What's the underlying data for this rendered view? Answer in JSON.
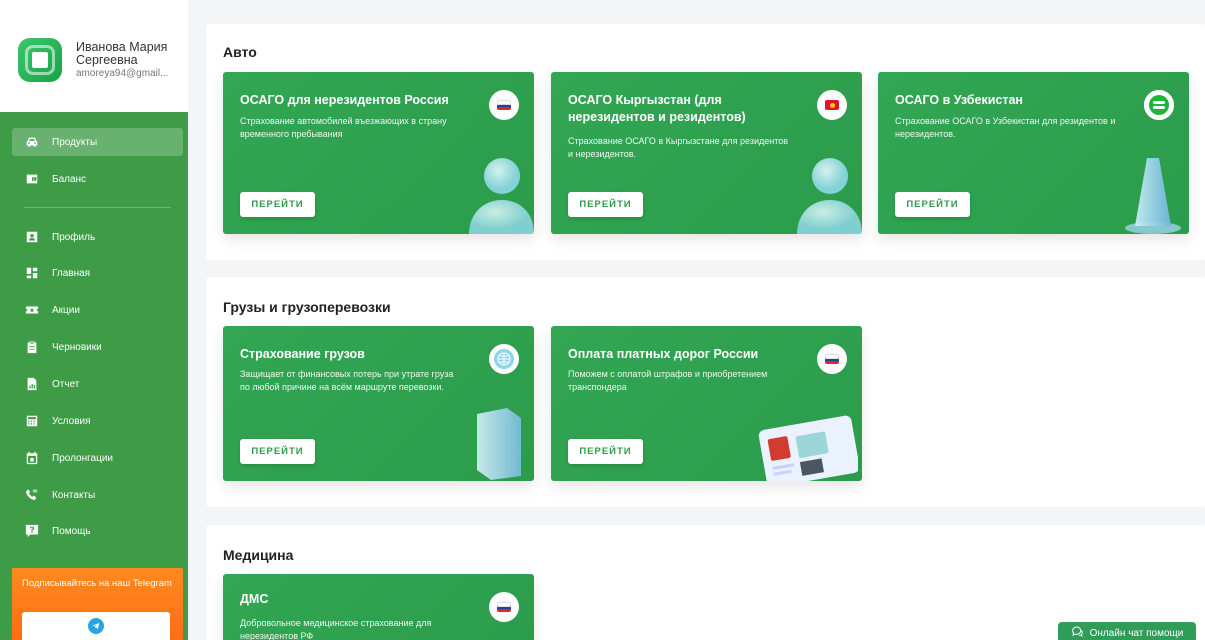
{
  "user": {
    "name": "Иванова Мария Сергеевна",
    "email": "amoreya94@gmail..."
  },
  "nav": {
    "items": [
      {
        "label": "Продукты",
        "icon": "car-icon",
        "active": true
      },
      {
        "label": "Баланс",
        "icon": "wallet-icon"
      },
      {
        "label": "Профиль",
        "icon": "profile-icon"
      },
      {
        "label": "Главная",
        "icon": "dashboard-icon"
      },
      {
        "label": "Акции",
        "icon": "ticket-icon"
      },
      {
        "label": "Черновики",
        "icon": "clipboard-icon"
      },
      {
        "label": "Отчет",
        "icon": "report-icon"
      },
      {
        "label": "Условия",
        "icon": "calculator-icon"
      },
      {
        "label": "Пролонгации",
        "icon": "calendar-icon"
      },
      {
        "label": "Контакты",
        "icon": "phone-icon"
      },
      {
        "label": "Помощь",
        "icon": "help-icon"
      }
    ]
  },
  "telegram": {
    "text": "Подписывайтесь на наш Telegram",
    "icon": "telegram-icon"
  },
  "sections": [
    {
      "title": "Авто",
      "cards": [
        {
          "title": "ОСАГО для нерезидентов Россия",
          "desc": "Страхование автомобилей въезжающих в страну временного пребывания",
          "button": "ПЕРЕЙТИ",
          "flag": "russia-flag-icon"
        },
        {
          "title": "ОСАГО Кыргызстан (для нерезидентов и резидентов)",
          "desc": "Страхование ОСАГО в Кыргызстане для резидентов и нерезидентов.",
          "button": "ПЕРЕЙТИ",
          "flag": "kyrgyzstan-flag-icon"
        },
        {
          "title": "ОСАГО в Узбекистан",
          "desc": "Страхование ОСАГО в Узбекистан для резидентов и нерезидентов.",
          "button": "ПЕРЕЙТИ",
          "flag": "uzbekistan-flag-icon"
        }
      ]
    },
    {
      "title": "Грузы и грузоперевозки",
      "cards": [
        {
          "title": "Страхование грузов",
          "desc": "Защищает от финансовых потерь при утрате груза по любой причине на всём маршруте перевозки.",
          "button": "ПЕРЕЙТИ",
          "flag": "globe-icon"
        },
        {
          "title": "Оплата платных дорог России",
          "desc": "Поможем с оплатой штрафов и приобретением транспондера",
          "button": "ПЕРЕЙТИ",
          "flag": "russia-flag-icon"
        }
      ]
    },
    {
      "title": "Медицина",
      "cards": [
        {
          "title": "ДМС",
          "desc": "Добровольное медицинское страхование для нерезидентов РФ",
          "flag": "russia-flag-icon"
        }
      ]
    }
  ],
  "chat": {
    "label": "Онлайн чат помощи",
    "icon": "chat-icon"
  },
  "colors": {
    "brand_green": "#3e9c47",
    "card_green": "#2f9f50",
    "telegram_orange": "#ff7a1a",
    "russia_flag": [
      "#ffffff",
      "#1c3fa8",
      "#d52b1e"
    ]
  }
}
